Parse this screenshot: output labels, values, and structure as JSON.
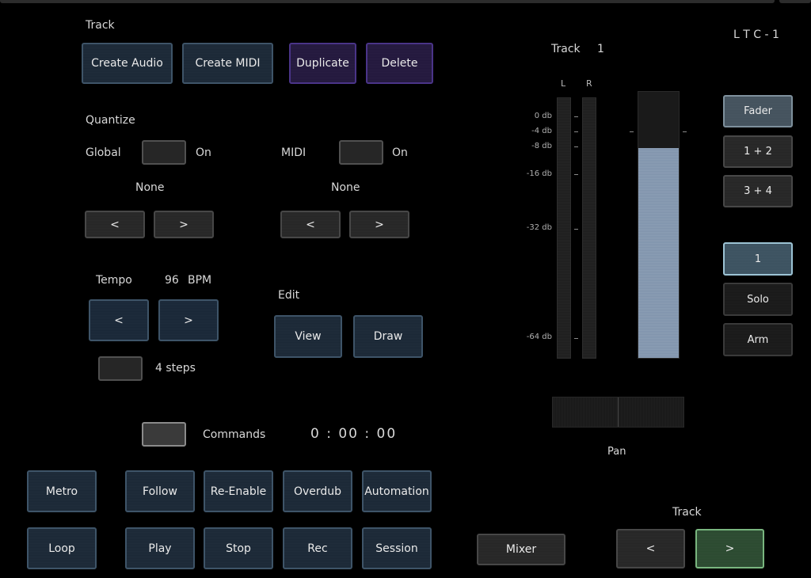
{
  "track": {
    "heading": "Track",
    "create_audio": "Create Audio",
    "create_midi": "Create MIDI",
    "duplicate": "Duplicate",
    "delete": "Delete"
  },
  "quantize": {
    "heading": "Quantize",
    "global_label": "Global",
    "global_on": "On",
    "global_value": "None",
    "midi_label": "MIDI",
    "midi_on": "On",
    "midi_value": "None",
    "prev": "<",
    "next": ">"
  },
  "tempo": {
    "label": "Tempo",
    "value": "96",
    "unit": "BPM",
    "prev": "<",
    "next": ">",
    "steps": "4 steps"
  },
  "edit": {
    "heading": "Edit",
    "view": "View",
    "draw": "Draw"
  },
  "commands": {
    "label": "Commands",
    "timecode": "0 : 00 : 00"
  },
  "transport": {
    "metro": "Metro",
    "follow": "Follow",
    "reenable": "Re-Enable",
    "overdub": "Overdub",
    "automation": "Automation",
    "loop": "Loop",
    "play": "Play",
    "stop": "Stop",
    "rec": "Rec",
    "session": "Session"
  },
  "mixer_button": "Mixer",
  "track_nav": {
    "label": "Track",
    "prev": "<",
    "next": ">"
  },
  "ltc": "L T C - 1",
  "meter": {
    "track_label": "Track",
    "track_number": "1",
    "left": "L",
    "right": "R",
    "db_labels": [
      "0 db",
      "-4 db",
      "-8 db",
      "-16 db",
      "-32 db",
      "-64 db"
    ],
    "fader_level": 0.79,
    "pan_label": "Pan"
  },
  "side_buttons": {
    "fader": "Fader",
    "one_two": "1 + 2",
    "three_four": "3 + 4",
    "track_num": "1",
    "solo": "Solo",
    "arm": "Arm"
  }
}
